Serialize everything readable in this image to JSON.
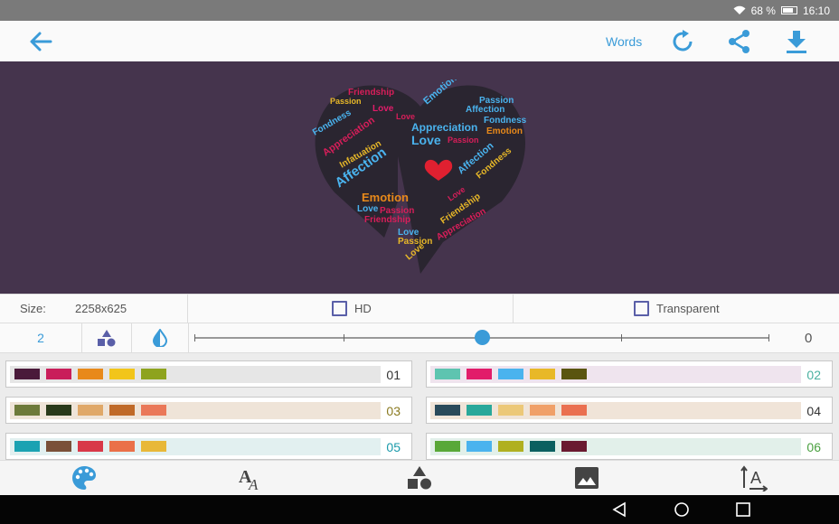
{
  "status_bar": {
    "battery": "68 %",
    "time": "16:10",
    "wifi_icon": "wifi-icon",
    "battery_icon": "battery-icon"
  },
  "toolbar": {
    "back_icon": "arrow-left-icon",
    "words_label": "Words",
    "refresh_icon": "refresh-icon",
    "share_icon": "share-icon",
    "download_icon": "download-icon"
  },
  "canvas": {
    "background": "#45344d",
    "words": [
      "Friendship",
      "Passion",
      "Love",
      "Fondness",
      "Appreciation",
      "Infatuation",
      "Affection",
      "Emotion",
      "Love",
      "Passion",
      "Affection",
      "Fondness",
      "Appreciation",
      "Love",
      "Emotion",
      "Passion",
      "Affection",
      "Fondness",
      "Emotion",
      "Love",
      "Passion",
      "Friendship",
      "Love",
      "Passion",
      "Love",
      "Friendship",
      "Love",
      "Appreciation"
    ]
  },
  "size_bar": {
    "size_label": "Size:",
    "size_value": "2258x625",
    "hd_label": "HD",
    "transparent_label": "Transparent",
    "hd_checked": false,
    "transparent_checked": false
  },
  "controls": {
    "count_value": "2",
    "shapes_icon": "shapes-icon",
    "contrast_icon": "contrast-icon",
    "slider_value": "0",
    "slider_position": 0.5
  },
  "palettes": [
    {
      "label": "01",
      "label_color": "#333333",
      "bg": "#e6e6e6",
      "colors": [
        "#4a1a3a",
        "#c91e5a",
        "#e8891a",
        "#f2c51a",
        "#8ea31e"
      ]
    },
    {
      "label": "02",
      "label_color": "#4ab0a0",
      "bg": "#efe4ee",
      "colors": [
        "#5ec4b0",
        "#e21c6a",
        "#4ab3ee",
        "#e8b828",
        "#5a5510"
      ]
    },
    {
      "label": "03",
      "label_color": "#8a7a20",
      "bg": "#efe4d8",
      "colors": [
        "#6e7a3a",
        "#2a3a1a",
        "#e0a868",
        "#c06a28",
        "#ea7858"
      ]
    },
    {
      "label": "04",
      "label_color": "#333333",
      "bg": "#f0e4d8",
      "colors": [
        "#2a4a5a",
        "#2aa89a",
        "#ecc878",
        "#f0a068",
        "#ea7050"
      ]
    },
    {
      "label": "05",
      "label_color": "#1a9aaa",
      "bg": "#e2f0f0",
      "colors": [
        "#1aa2b2",
        "#7a5038",
        "#d83848",
        "#ea7048",
        "#e8b838"
      ]
    },
    {
      "label": "06",
      "label_color": "#4aa040",
      "bg": "#e2f0ea",
      "colors": [
        "#58a838",
        "#4ab3ee",
        "#b0b020",
        "#0a6060",
        "#6a1a30"
      ]
    }
  ],
  "bottom_nav": {
    "palette_icon": "palette-icon",
    "font_icon": "font-icon",
    "shapes_icon": "shapes-icon",
    "image_icon": "image-icon",
    "text_orientation_icon": "text-orientation-icon"
  },
  "system_nav": {
    "back_icon": "triangle-back-icon",
    "home_icon": "circle-home-icon",
    "recents_icon": "square-recents-icon"
  }
}
